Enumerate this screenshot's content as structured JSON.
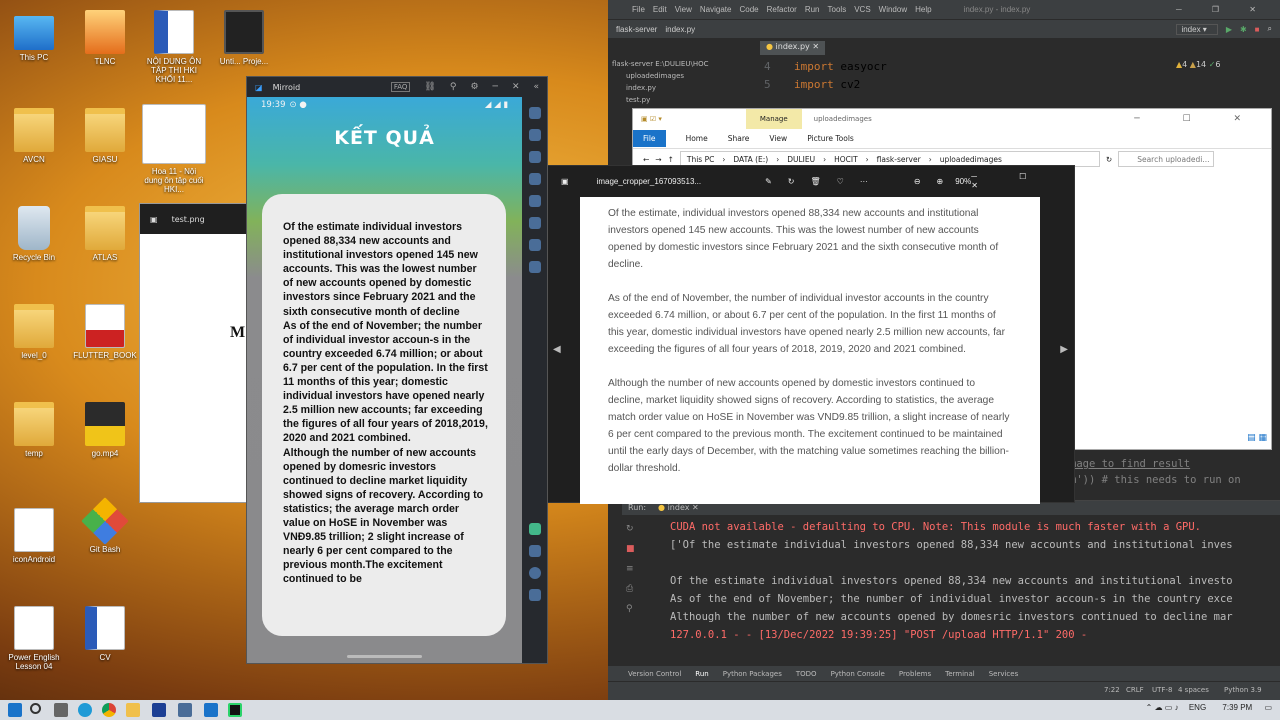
{
  "desktop": {
    "icons": [
      {
        "label": "This PC"
      },
      {
        "label": "TLNC"
      },
      {
        "label": "NỘI DUNG ÔN TẬP THI HKI KHỐI 11..."
      },
      {
        "label": "Unti... Proje..."
      },
      {
        "label": "AVCN"
      },
      {
        "label": "GIASU"
      },
      {
        "label": "Hoa 11 - Nội dung ôn tập cuối HKI..."
      },
      {
        "label": "Recycle Bin"
      },
      {
        "label": "ATLAS"
      },
      {
        "label": "level_0"
      },
      {
        "label": "FLUTTER_BOOK"
      },
      {
        "label": "temp"
      },
      {
        "label": "go.mp4"
      },
      {
        "label": "iconAndroid"
      },
      {
        "label": "Git Bash"
      },
      {
        "label": "Power English Lesson 04"
      },
      {
        "label": "CV"
      }
    ]
  },
  "test_window": {
    "title": "test.png",
    "partial_text": "M"
  },
  "mirroid": {
    "title": "Mirroid",
    "faq": "FAQ",
    "phone_time": "19:39",
    "heading": "KẾT QUẢ",
    "result_text": "Of the estimate individual investors opened 88,334 new accounts and institutional investors opened 145 new accounts. This was the lowest number of new accounts opened by domestic investors since February 2021 and the sixth consecutive month of decline\nAs of the end of November; the number of individual investor accoun-s in the country exceeded 6.74 million; or about 6.7 per cent of the population. In the first 11 months of this year; domestic individual investors have opened nearly 2.5 million new accounts; far exceeding the figures of all four years of 2018,2019, 2020 and 2021 combined.\nAlthough the number of new accounts opened by domesric investors continued to decline market liquidity showed signs of recovery. According to statistics; the average march order value on HoSE in November was VNĐ9.85 trillion; 2 slight increase of nearly 6 per cent compared to the previous month.The excitement continued to be"
  },
  "viewer": {
    "filename": "image_cropper_167093513...",
    "zoom": "90%",
    "paragraphs": [
      "Of the estimate, individual investors opened 88,334 new accounts and institutional investors opened 145 new accounts. This was the lowest number of new accounts opened by domestic investors since February 2021 and the sixth consecutive month of decline.",
      "As of the end of November, the number of individual investor accounts in the country exceeded 6.74 million, or about 6.7 per cent of the population. In the first 11 months of this year, domestic individual investors have opened nearly 2.5 million new accounts, far exceeding the figures of all four years of 2018, 2019, 2020 and 2021 combined.",
      "Although the number of new accounts opened by domestic investors continued to decline, market liquidity showed signs of recovery. According to statistics, the average match order value on HoSE in November was VND9.85 trillion, a slight increase of nearly 6 per cent compared to the previous month. The excitement continued to be maintained until the early days of December, with the matching value sometimes reaching the billion-dollar threshold."
    ]
  },
  "explorer": {
    "context_tab": "Manage",
    "folder_title": "uploadedimages",
    "ribbon": [
      "File",
      "Home",
      "Share",
      "View",
      "Picture Tools"
    ],
    "path": [
      "This PC",
      "DATA (E:)",
      "DULIEU",
      "HOCIT",
      "flask-server",
      "uploadedimages"
    ],
    "search_placeholder": "Search uploadedi..."
  },
  "ide": {
    "menu": [
      "File",
      "Edit",
      "View",
      "Navigate",
      "Code",
      "Refactor",
      "Run",
      "Tools",
      "VCS",
      "Window",
      "Help"
    ],
    "window_title": "index.py - index.py",
    "project": "flask-server",
    "file": "index.py",
    "run_config": "index",
    "editor_tab": "index.py",
    "project_tree": [
      "flask-server  E:\\DULIEU\\HOC",
      "uploadedimages",
      "index.py",
      "test.py"
    ],
    "code_lines": [
      {
        "num": "4",
        "kw": "import",
        "rest": " easyocr"
      },
      {
        "num": "5",
        "kw": "import",
        "rest": " cv2"
      }
    ],
    "inspections": {
      "warnings": "4",
      "weak": "14",
      "typos": "6"
    },
    "ghost_code": [
      "mage to find result",
      "m')) # this needs to run on"
    ],
    "run_label": "Run:",
    "run_tab": "index",
    "console": [
      {
        "cls": "red",
        "text": "CUDA not available - defaulting to CPU. Note: This module is much faster with a GPU."
      },
      {
        "cls": "grey",
        "text": "['Of the estimate individual investors opened 88,334 new accounts and institutional inves"
      },
      {
        "cls": "grey",
        "text": ""
      },
      {
        "cls": "grey",
        "text": "Of the estimate individual investors opened 88,334 new accounts and institutional investo"
      },
      {
        "cls": "grey",
        "text": "As of the end of November; the number of individual investor accoun-s in the country exce"
      },
      {
        "cls": "grey",
        "text": "Although the number of new accounts opened by domesric investors continued to decline mar"
      },
      {
        "cls": "red",
        "text": "127.0.0.1 - - [13/Dec/2022 19:39:25] \"POST /upload HTTP/1.1\" 200 -"
      }
    ],
    "bottom_tabs": [
      "Version Control",
      "Run",
      "Python Packages",
      "TODO",
      "Python Console",
      "Problems",
      "Terminal",
      "Services"
    ],
    "status": {
      "pos": "7:22",
      "eol": "CRLF",
      "enc": "UTF-8",
      "indent": "4 spaces",
      "interp": "Python 3.9"
    }
  },
  "taskbar": {
    "lang": "ENG",
    "time": "7:39 PM"
  },
  "colors": {
    "ide_bg": "#2b2b2b",
    "console_red": "#ff6b68",
    "accent_blue": "#1a73c9"
  }
}
